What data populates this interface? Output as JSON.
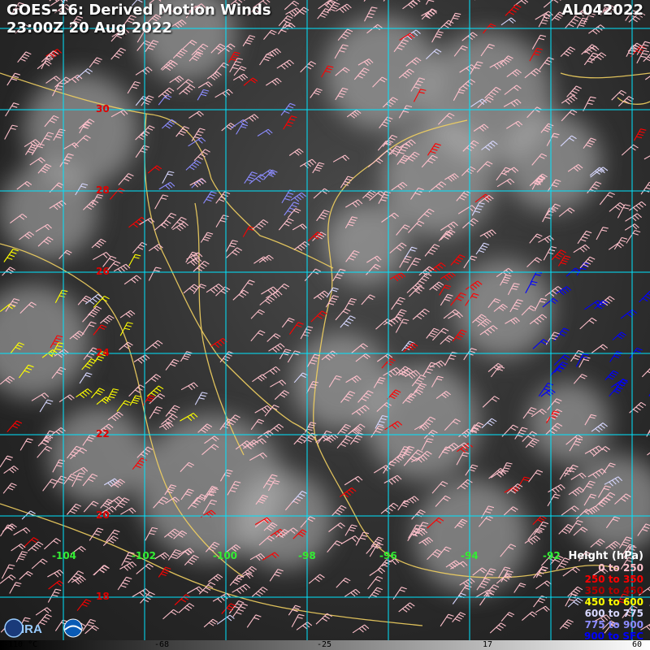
{
  "header": {
    "title": "GOES-16: Derived Motion Winds",
    "datetime": "23:00Z 20 Aug 2022",
    "storm_id": "AL042022"
  },
  "grid": {
    "lat_labels": [
      "30",
      "28",
      "26",
      "24",
      "22",
      "20",
      "18"
    ],
    "lon_labels": [
      "-104",
      "-102",
      "-100",
      "-98",
      "-96",
      "-94",
      "-92"
    ],
    "line_color": "#00e5ff"
  },
  "coast_color": "#f2d060",
  "legend": {
    "title": "Height (hPa)",
    "items": [
      {
        "label": "0 to 250",
        "color": "#ffc0cb"
      },
      {
        "label": "250 to 350",
        "color": "#ff0000"
      },
      {
        "label": "350 to 450",
        "color": "#b00000"
      },
      {
        "label": "450 to 600",
        "color": "#ffff00"
      },
      {
        "label": "600 to 775",
        "color": "#d8d8ff"
      },
      {
        "label": "775 to 900",
        "color": "#8c8cff"
      },
      {
        "label": "900 to SFC",
        "color": "#0000ff"
      }
    ]
  },
  "colorbar": {
    "labels": [
      "-110 °C",
      "-68",
      "-25",
      "17",
      "60"
    ]
  },
  "logos": [
    "cira-logo",
    "noaa-logo"
  ]
}
